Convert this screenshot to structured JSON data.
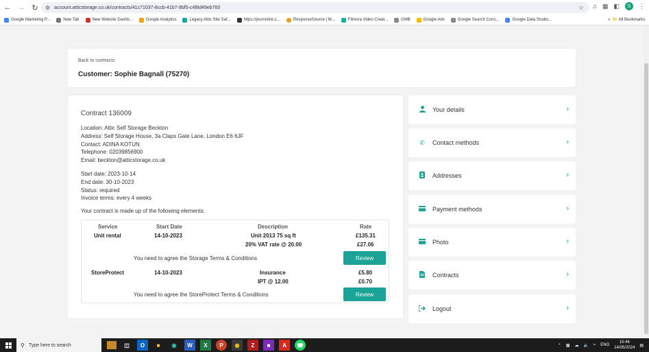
{
  "browser": {
    "url": "account.atticstorage.co.uk/contracts/41c71037-8ccb-41b7-9bf5-c4f8d49eb760",
    "profile_initial": "S",
    "bookmarks": [
      {
        "label": "Google Marketing P...",
        "color": "#4285f4"
      },
      {
        "label": "New Tab",
        "color": "#777777"
      },
      {
        "label": "New Website Dashb...",
        "color": "#d93025"
      },
      {
        "label": "Google Analytics",
        "color": "#f4a000"
      },
      {
        "label": "Legacy Attic Site Saf...",
        "color": "#1ba398"
      },
      {
        "label": "https://journolink.c...",
        "color": "#333333"
      },
      {
        "label": "ResponseSource | M...",
        "color": "#f09a1a"
      },
      {
        "label": "Filmora Video Creat...",
        "color": "#1bb0a0"
      },
      {
        "label": "GMB",
        "color": "#888888"
      },
      {
        "label": "Google Ads",
        "color": "#fbbc04"
      },
      {
        "label": "Google Search Cons...",
        "color": "#888888"
      },
      {
        "label": "Google Data Studio...",
        "color": "#4285f4"
      }
    ],
    "all_bookmarks": "All Bookmarks"
  },
  "header": {
    "back_link": "Back to contracts",
    "customer": "Customer: Sophie Bagnall (75270)"
  },
  "contract": {
    "title": "Contract 136009",
    "location": "Location: Attic Self Storage Beckton",
    "address": "Address: Self Storage House, 3a Claps Gate Lane, London E6 6JF",
    "contact": "Contact: ADINA KOTUN",
    "telephone": "Telephone: 02039856900",
    "email": "Email: beckton@atticstorage.co.uk",
    "start_date": "Start date: 2023-10-14",
    "end_date": "End date: 30-10-2023",
    "status": "Status: required",
    "invoice_terms": "Invoice terms: every 4 weeks",
    "elements_intro": "Your contract is made up of the following elements:",
    "columns": {
      "service": "Service",
      "start_date": "Start Date",
      "description": "Description",
      "rate": "Rate"
    },
    "elements": [
      {
        "service": "Unit rental",
        "start": "14-10-2023",
        "desc1": "Unit 2013 75 sq ft",
        "rate1": "£135.31",
        "desc2": "20% VAT rate @ 20.00",
        "rate2": "£27.06",
        "note": "You need to agree the Storage Terms & Conditions",
        "button": "Review"
      },
      {
        "service": "StoreProtect",
        "start": "14-10-2023",
        "desc1": "Insurance",
        "rate1": "£5.80",
        "desc2": "IPT @ 12.00",
        "rate2": "£0.70",
        "note": "You need to agree the StoreProtect Terms & Conditions",
        "button": "Review"
      }
    ]
  },
  "menu": [
    {
      "label": "Your details",
      "icon": "person-icon"
    },
    {
      "label": "Contact methods",
      "icon": "phone-icon"
    },
    {
      "label": "Addresses",
      "icon": "address-book-icon"
    },
    {
      "label": "Payment methods",
      "icon": "credit-card-icon"
    },
    {
      "label": "Photo",
      "icon": "image-icon"
    },
    {
      "label": "Contracts",
      "icon": "document-icon"
    },
    {
      "label": "Logout",
      "icon": "logout-icon"
    }
  ],
  "taskbar": {
    "search_placeholder": "Type here to search",
    "language": "ENG",
    "time": "15:46",
    "date": "14/05/2024"
  },
  "colors": {
    "accent": "#1ba398",
    "page_bg": "#f3f3f3"
  }
}
